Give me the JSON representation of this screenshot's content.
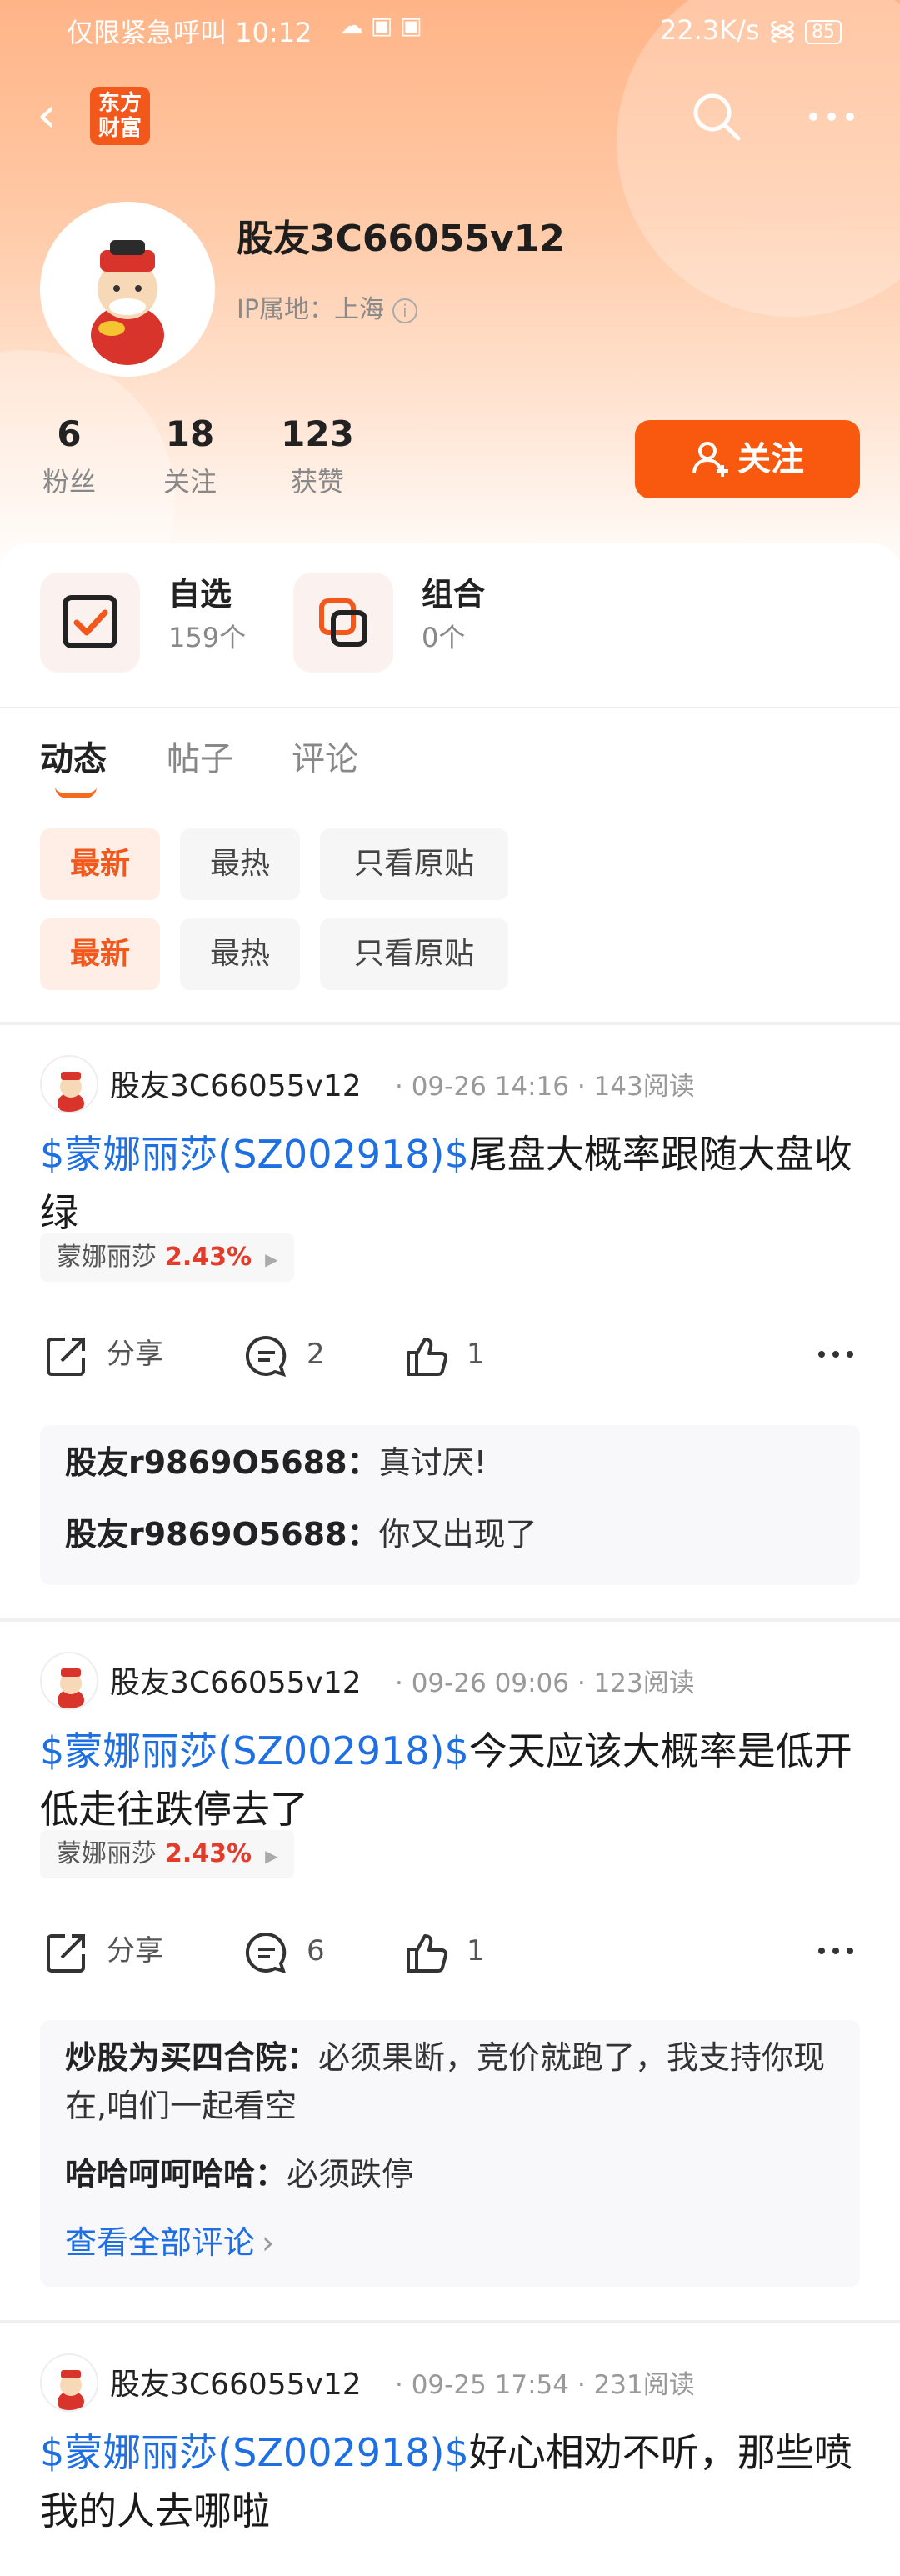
{
  "status_bar": {
    "left_text": "仅限紧急呼叫",
    "time": "10:12",
    "speed": "22.3K/s",
    "battery": "85"
  },
  "nav": {
    "logo_text": "东方财富",
    "back_icon": "back-arrow-icon",
    "search_icon": "search-icon",
    "more_icon": "more-icon"
  },
  "profile": {
    "username": "股友3C66055v12",
    "ip_label": "IP属地：上海",
    "stats": [
      {
        "value": "6",
        "label": "粉丝"
      },
      {
        "value": "18",
        "label": "关注"
      },
      {
        "value": "123",
        "label": "获赞"
      }
    ],
    "follow_label": "关注"
  },
  "quick": [
    {
      "title": "自选",
      "sub": "159个"
    },
    {
      "title": "组合",
      "sub": "0个"
    }
  ],
  "tabs": [
    {
      "label": "动态",
      "active": true
    },
    {
      "label": "帖子",
      "active": false
    },
    {
      "label": "评论",
      "active": false
    }
  ],
  "filters": {
    "row1": [
      "最新",
      "最热",
      "只看原贴"
    ],
    "row2": [
      "最新",
      "最热",
      "只看原贴"
    ]
  },
  "posts": [
    {
      "author": "股友3C66055v12",
      "meta": "· 09-26 14:16 · 143阅读",
      "tag": "$蒙娜丽莎(SZ002918)$",
      "text": "尾盘大概率跟随大盘收绿",
      "stock_name": "蒙娜丽莎",
      "stock_pct": "2.43%",
      "share": "分享",
      "comments": "2",
      "likes": "1",
      "replies": [
        {
          "user": "股友r9869O5688：",
          "text": "真讨厌!"
        },
        {
          "user": "股友r9869O5688：",
          "text": "你又出现了"
        }
      ]
    },
    {
      "author": "股友3C66055v12",
      "meta": "· 09-26 09:06 · 123阅读",
      "tag": "$蒙娜丽莎(SZ002918)$",
      "text": "今天应该大概率是低开低走往跌停去了",
      "stock_name": "蒙娜丽莎",
      "stock_pct": "2.43%",
      "share": "分享",
      "comments": "6",
      "likes": "1",
      "replies": [
        {
          "user": "炒股为买四合院：",
          "text": "必须果断，竞价就跑了，我支持你现在,咱们一起看空"
        },
        {
          "user": "哈哈呵呵哈哈：",
          "text": "必须跌停"
        }
      ],
      "view_all": "查看全部评论"
    },
    {
      "author": "股友3C66055v12",
      "meta": "· 09-25 17:54 · 231阅读",
      "tag": "$蒙娜丽莎(SZ002918)$",
      "text": "好心相劝不听，那些喷我的人去哪啦"
    }
  ],
  "colors": {
    "accent": "#f9580f",
    "link": "#1d6fe3",
    "up": "#e43c2b"
  }
}
